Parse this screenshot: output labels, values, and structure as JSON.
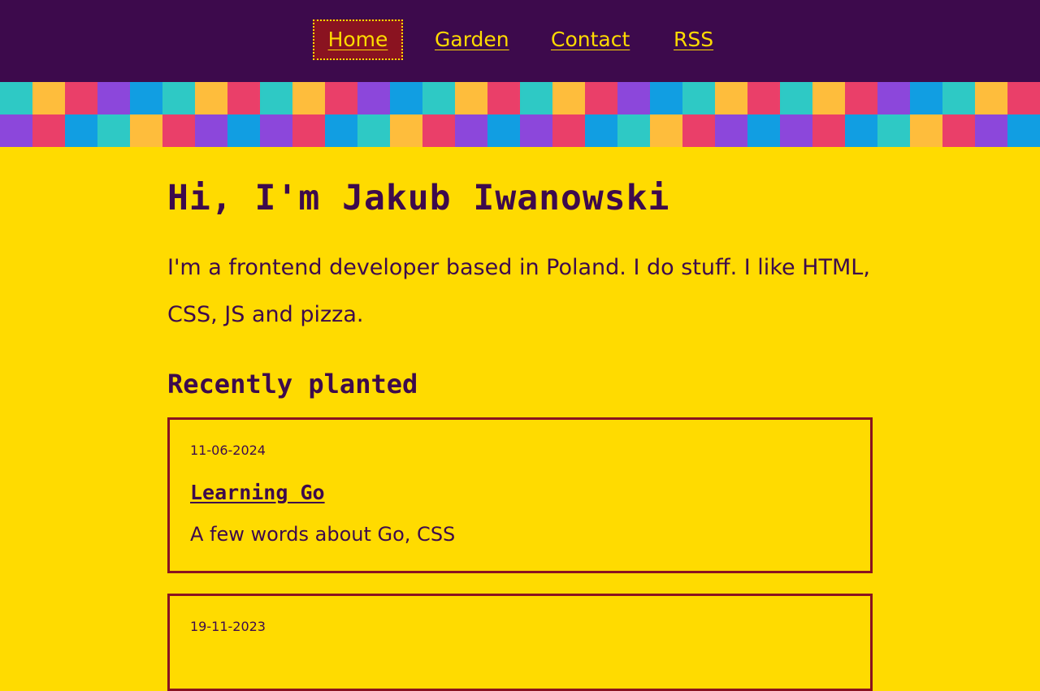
{
  "nav": {
    "links": [
      {
        "label": "Home",
        "active": true
      },
      {
        "label": "Garden",
        "active": false
      },
      {
        "label": "Contact",
        "active": false
      },
      {
        "label": "RSS",
        "active": false
      }
    ]
  },
  "colors": {
    "background": "#ffdb00",
    "nav_background": "#3d0a4c",
    "text": "#3d0a4c",
    "active_nav": "#8a1320",
    "card_border": "#8a1320",
    "mosaic": [
      "#2ec9c5",
      "#febd3c",
      "#ea3f69",
      "#8c47db",
      "#119ee2"
    ]
  },
  "mosaic": {
    "row1": [
      "#2ec9c5",
      "#febd3c",
      "#ea3f69",
      "#8c47db",
      "#119ee2",
      "#2ec9c5",
      "#febd3c",
      "#ea3f69",
      "#2ec9c5",
      "#febd3c",
      "#ea3f69",
      "#8c47db",
      "#119ee2",
      "#2ec9c5",
      "#febd3c",
      "#ea3f69",
      "#2ec9c5",
      "#febd3c",
      "#ea3f69",
      "#8c47db",
      "#119ee2",
      "#2ec9c5",
      "#febd3c",
      "#ea3f69",
      "#2ec9c5",
      "#febd3c",
      "#ea3f69",
      "#8c47db",
      "#119ee2",
      "#2ec9c5",
      "#febd3c",
      "#ea3f69"
    ],
    "row2": [
      "#8c47db",
      "#ea3f69",
      "#119ee2",
      "#2ec9c5",
      "#febd3c",
      "#ea3f69",
      "#8c47db",
      "#119ee2",
      "#8c47db",
      "#ea3f69",
      "#119ee2",
      "#2ec9c5",
      "#febd3c",
      "#ea3f69",
      "#8c47db",
      "#119ee2",
      "#8c47db",
      "#ea3f69",
      "#119ee2",
      "#2ec9c5",
      "#febd3c",
      "#ea3f69",
      "#8c47db",
      "#119ee2",
      "#8c47db",
      "#ea3f69",
      "#119ee2",
      "#2ec9c5",
      "#febd3c",
      "#ea3f69",
      "#8c47db",
      "#119ee2"
    ]
  },
  "hero": {
    "heading": "Hi, I'm Jakub Iwanowski",
    "intro": "I'm a frontend developer based in Poland. I do stuff. I like HTML, CSS, JS and pizza."
  },
  "recent": {
    "heading": "Recently planted",
    "posts": [
      {
        "date": "11-06-2024",
        "title": "Learning Go",
        "description": "A few words about Go, CSS"
      },
      {
        "date": "19-11-2023",
        "title": "",
        "description": ""
      }
    ]
  }
}
